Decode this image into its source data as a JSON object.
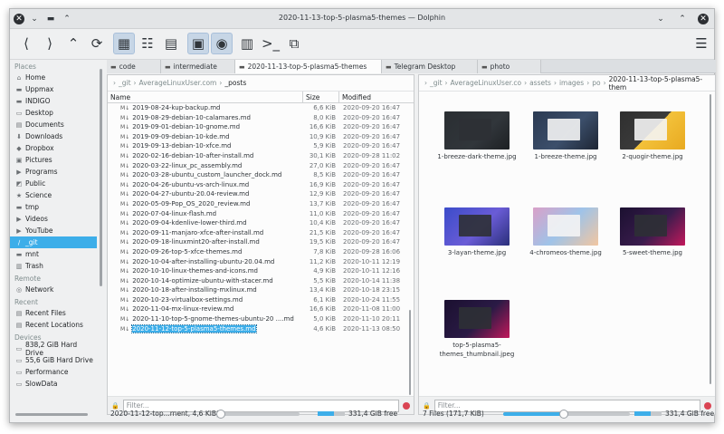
{
  "window": {
    "title": "2020-11-13-top-5-plasma5-themes — Dolphin"
  },
  "toolbar": {
    "back": "back-icon",
    "forward": "forward-icon",
    "up": "up-icon",
    "reload": "reload-icon",
    "views": [
      "icons-view-icon",
      "compact-view-icon",
      "details-view-icon"
    ],
    "preview": "preview-icon",
    "hidden": "eye-icon",
    "split": "split-icon",
    "terminal": "terminal-icon",
    "newwin": "new-window-icon",
    "menu": "hamburger-icon"
  },
  "places": {
    "sections": [
      {
        "title": "Places",
        "items": [
          {
            "icon": "home-icon",
            "label": "Home"
          },
          {
            "icon": "folder-icon",
            "label": "Uppmax"
          },
          {
            "icon": "folder-icon",
            "label": "INDIGO"
          },
          {
            "icon": "desktop-icon",
            "label": "Desktop"
          },
          {
            "icon": "documents-icon",
            "label": "Documents"
          },
          {
            "icon": "downloads-icon",
            "label": "Downloads"
          },
          {
            "icon": "dropbox-icon",
            "label": "Dropbox"
          },
          {
            "icon": "pictures-icon",
            "label": "Pictures"
          },
          {
            "icon": "programs-icon",
            "label": "Programs"
          },
          {
            "icon": "public-icon",
            "label": "Public"
          },
          {
            "icon": "star-icon",
            "label": "Science"
          },
          {
            "icon": "folder-icon",
            "label": "tmp"
          },
          {
            "icon": "videos-icon",
            "label": "Videos"
          },
          {
            "icon": "youtube-icon",
            "label": "YouTube"
          },
          {
            "icon": "git-icon",
            "label": "_git",
            "selected": true
          },
          {
            "icon": "folder-icon",
            "label": "mnt"
          },
          {
            "icon": "trash-icon",
            "label": "Trash"
          }
        ]
      },
      {
        "title": "Remote",
        "items": [
          {
            "icon": "network-icon",
            "label": "Network"
          }
        ]
      },
      {
        "title": "Recent",
        "items": [
          {
            "icon": "recent-files-icon",
            "label": "Recent Files"
          },
          {
            "icon": "recent-locations-icon",
            "label": "Recent Locations"
          }
        ]
      },
      {
        "title": "Devices",
        "items": [
          {
            "icon": "drive-icon",
            "label": "838,2 GiB Hard Drive"
          },
          {
            "icon": "drive-icon",
            "label": "55,6 GiB Hard Drive"
          },
          {
            "icon": "drive-icon",
            "label": "Performance"
          },
          {
            "icon": "drive-icon",
            "label": "SlowData"
          }
        ]
      }
    ]
  },
  "tabs": [
    {
      "label": "code",
      "active": false
    },
    {
      "label": "intermediate",
      "active": false
    },
    {
      "label": "2020-11-13-top-5-plasma5-themes",
      "active": true
    },
    {
      "label": "Telegram Desktop",
      "active": false
    },
    {
      "label": "photo",
      "active": false
    }
  ],
  "left": {
    "breadcrumb": [
      "_git",
      "AverageLinuxUser.com",
      "_posts"
    ],
    "columns": {
      "name": "Name",
      "size": "Size",
      "modified": "Modified"
    },
    "rows": [
      {
        "name": "2019-08-24-kup-backup.md",
        "size": "6,6 KiB",
        "date": "2020-09-20 16:47"
      },
      {
        "name": "2019-08-29-debian-10-calamares.md",
        "size": "8,0 KiB",
        "date": "2020-09-20 16:47"
      },
      {
        "name": "2019-09-01-debian-10-gnome.md",
        "size": "16,6 KiB",
        "date": "2020-09-20 16:47"
      },
      {
        "name": "2019-09-09-debian-10-kde.md",
        "size": "10,9 KiB",
        "date": "2020-09-20 16:47"
      },
      {
        "name": "2019-09-13-debian-10-xfce.md",
        "size": "5,9 KiB",
        "date": "2020-09-20 16:47"
      },
      {
        "name": "2020-02-16-debian-10-after-install.md",
        "size": "30,1 KiB",
        "date": "2020-09-28 11:02"
      },
      {
        "name": "2020-03-22-linux_pc_assembly.md",
        "size": "27,0 KiB",
        "date": "2020-09-20 16:47"
      },
      {
        "name": "2020-03-28-ubuntu_custom_launcher_dock.md",
        "size": "8,5 KiB",
        "date": "2020-09-20 16:47"
      },
      {
        "name": "2020-04-26-ubuntu-vs-arch-linux.md",
        "size": "16,9 KiB",
        "date": "2020-09-20 16:47"
      },
      {
        "name": "2020-04-27-ubuntu-20.04-review.md",
        "size": "12,9 KiB",
        "date": "2020-09-20 16:47"
      },
      {
        "name": "2020-05-09-Pop_OS_2020_review.md",
        "size": "13,7 KiB",
        "date": "2020-09-20 16:47"
      },
      {
        "name": "2020-07-04-linux-flash.md",
        "size": "11,0 KiB",
        "date": "2020-09-20 16:47"
      },
      {
        "name": "2020-09-04-kdenlive-lower-third.md",
        "size": "10,4 KiB",
        "date": "2020-09-20 16:47"
      },
      {
        "name": "2020-09-11-manjaro-xfce-after-install.md",
        "size": "21,5 KiB",
        "date": "2020-09-20 16:47"
      },
      {
        "name": "2020-09-18-linuxmint20-after-install.md",
        "size": "19,5 KiB",
        "date": "2020-09-20 16:47"
      },
      {
        "name": "2020-09-26-top-5-xfce-themes.md",
        "size": "7,8 KiB",
        "date": "2020-09-28 16:06"
      },
      {
        "name": "2020-10-04-after-installing-ubuntu-20.04.md",
        "size": "11,2 KiB",
        "date": "2020-10-11 12:19"
      },
      {
        "name": "2020-10-10-linux-themes-and-icons.md",
        "size": "4,9 KiB",
        "date": "2020-10-11 12:16"
      },
      {
        "name": "2020-10-14-optimize-ubuntu-with-stacer.md",
        "size": "5,5 KiB",
        "date": "2020-10-14 11:38"
      },
      {
        "name": "2020-10-18-after-installing-mxlinux.md",
        "size": "13,4 KiB",
        "date": "2020-10-18 23:15"
      },
      {
        "name": "2020-10-23-virtualbox-settings.md",
        "size": "6,1 KiB",
        "date": "2020-10-24 11:55"
      },
      {
        "name": "2020-11-04-mx-linux-review.md",
        "size": "16,6 KiB",
        "date": "2020-11-08 11:00"
      },
      {
        "name": "2020-11-10-top-5-gnome-themes-ubuntu-20 ....md",
        "size": "5,0 KiB",
        "date": "2020-11-10 20:11"
      },
      {
        "name": "2020-11-12-top-5-plasma5-themes.md",
        "size": "4,6 KiB",
        "date": "2020-11-13 08:50",
        "selected": true
      }
    ],
    "filter_placeholder": "Filter...",
    "status": "2020-11-12-top...rnent, 4,6 KiB)",
    "free": "331,4 GiB free"
  },
  "right": {
    "breadcrumb": [
      "_git",
      "AverageLinuxUser.co",
      "assets",
      "images",
      "po",
      "2020-11-13-top-5-plasma5-them"
    ],
    "files": [
      {
        "label": "1-breeze-dark-theme.jpg",
        "theme": "dark"
      },
      {
        "label": "1-breeze-theme.jpg",
        "theme": "light"
      },
      {
        "label": "2-quogir-theme.jpg",
        "theme": "quogir"
      },
      {
        "label": "3-layan-theme.jpg",
        "theme": "layan"
      },
      {
        "label": "4-chromeos-theme.jpg",
        "theme": "chromeos"
      },
      {
        "label": "5-sweet-theme.jpg",
        "theme": "sweet"
      },
      {
        "label": "top-5-plasma5-themes_thumbnail.jpeg",
        "theme": "thumb"
      }
    ],
    "filter_placeholder": "Filter...",
    "status": "7 Files (171,7 KiB)",
    "free": "331,4 GiB free"
  },
  "colors": {
    "accent": "#3daee9",
    "close": "#da4453"
  }
}
